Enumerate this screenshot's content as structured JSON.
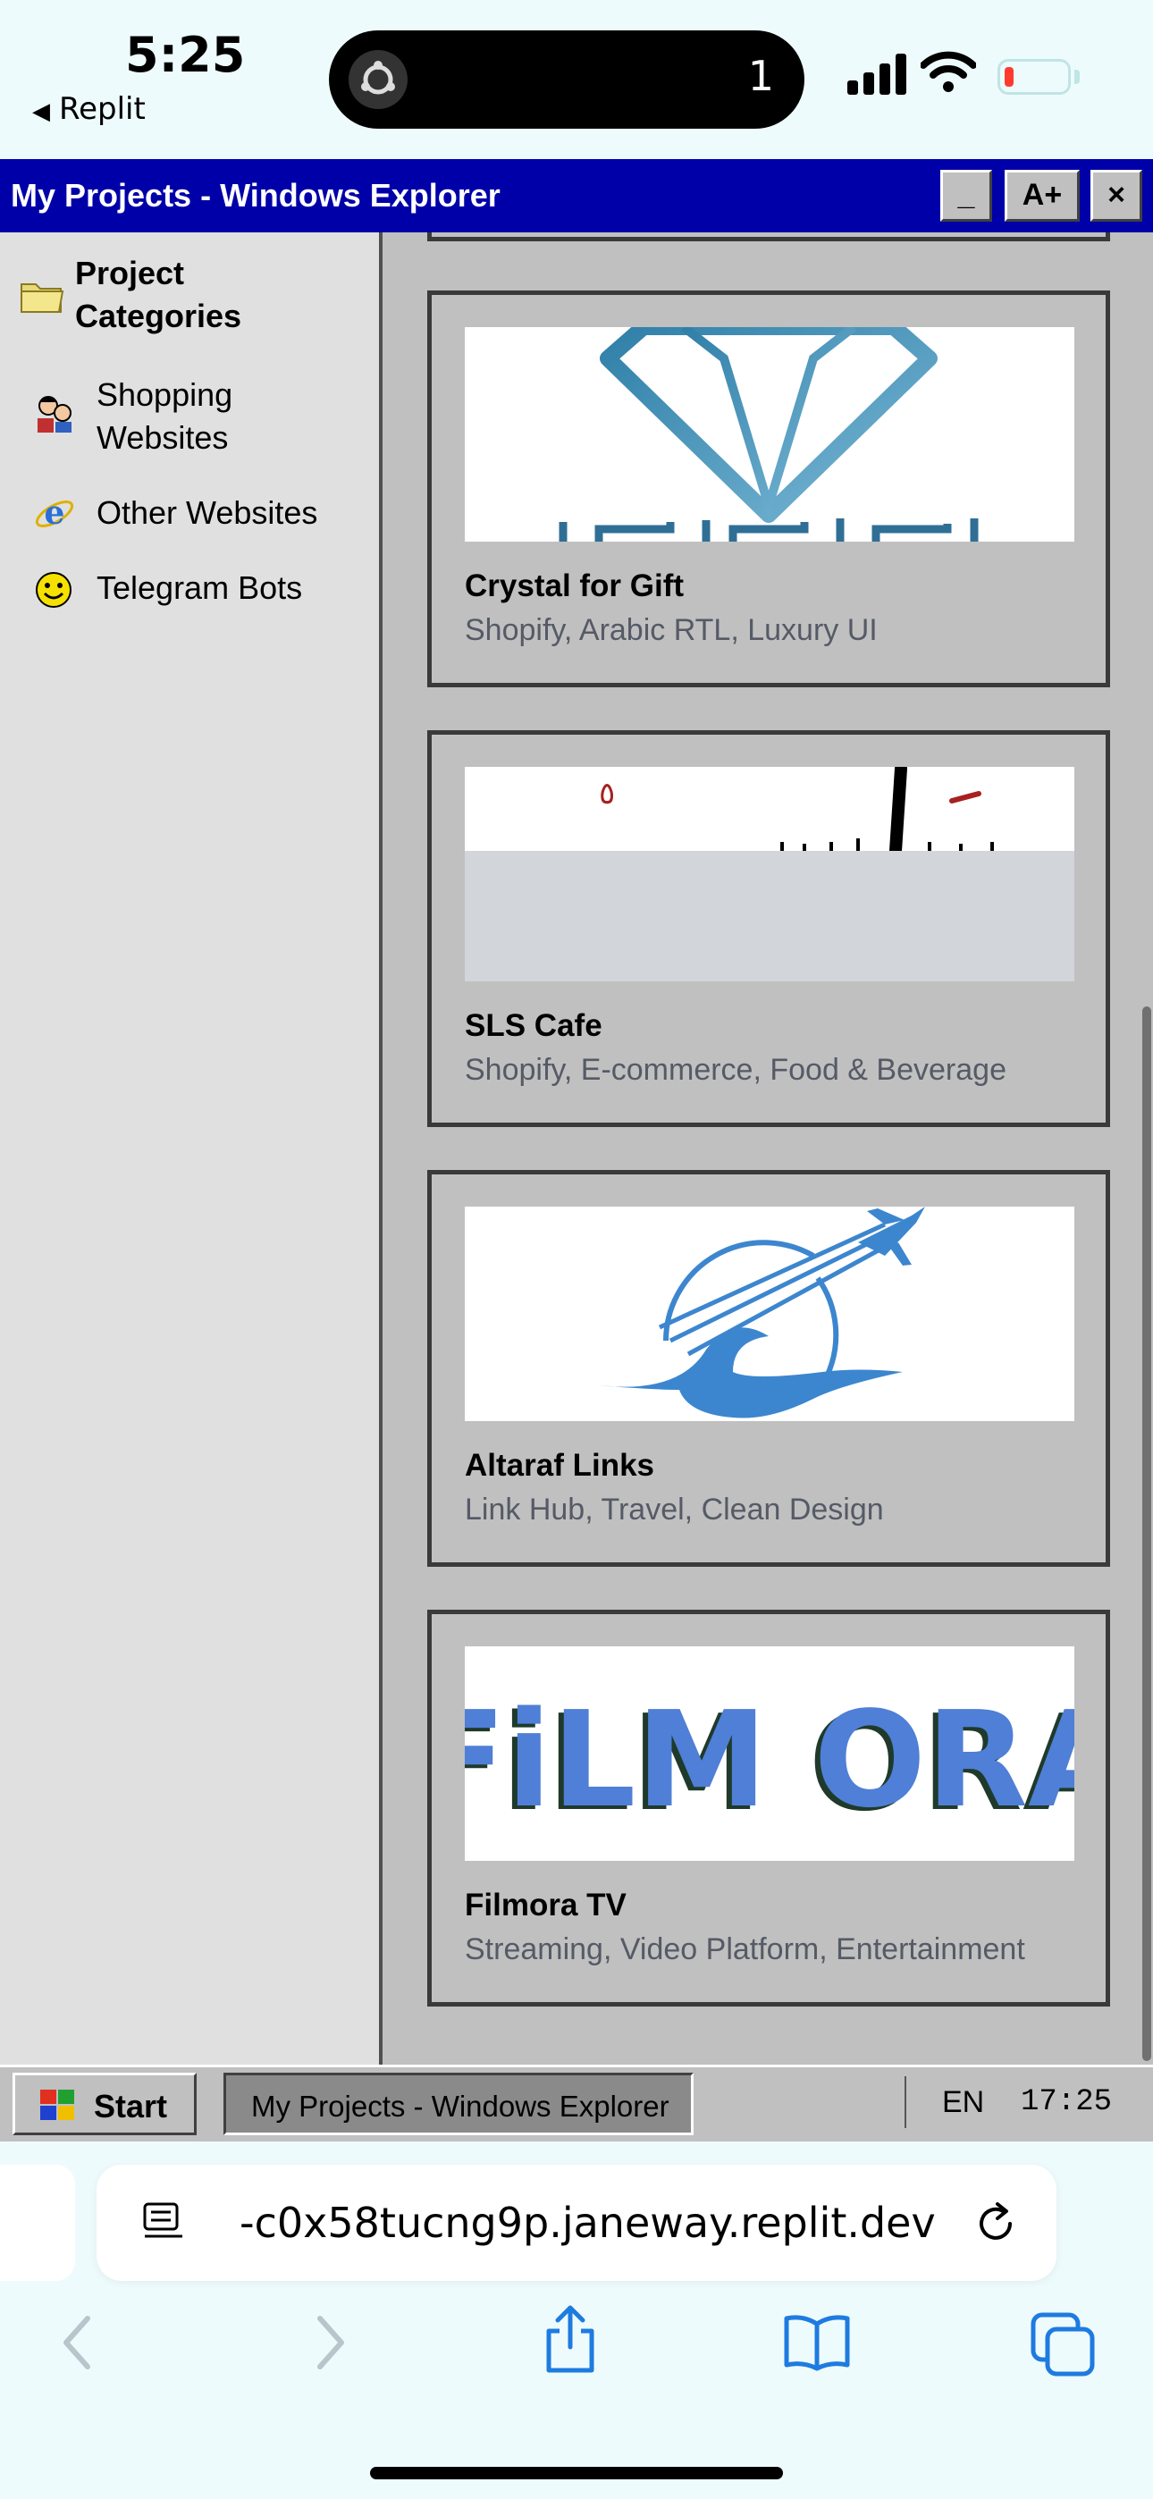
{
  "status_bar": {
    "time": "5:25",
    "back_app": "Replit",
    "island_count": "1",
    "battery_color": "#ff3b30"
  },
  "window": {
    "title": "My Projects - Windows Explorer",
    "buttons": {
      "minimize": "_",
      "font": "A+",
      "close": "×"
    },
    "title_color": "#0000a8"
  },
  "sidebar": {
    "heading": "Project Categories",
    "heading_icon": "folder-icon",
    "items": [
      {
        "label": "Shopping Websites",
        "icon": "shopping-people-icon"
      },
      {
        "label": "Other Websites",
        "icon": "internet-explorer-icon"
      },
      {
        "label": "Telegram Bots",
        "icon": "smiley-icon"
      }
    ]
  },
  "projects": [
    {
      "name": "Crystal for Gift",
      "tags": "Shopify, Arabic RTL, Luxury UI",
      "thumb": "diamond-logo"
    },
    {
      "name": "SLS Cafe",
      "tags": "Shopify, E-commerce, Food & Beverage",
      "thumb": "sls-cafe-logo",
      "thumb_mark": "٥"
    },
    {
      "name": "Altaraf Links",
      "tags": "Link Hub, Travel, Clean Design",
      "thumb": "plane-wave-logo"
    },
    {
      "name": "Filmora TV",
      "tags": "Streaming, Video Platform, Entertainment",
      "thumb": "filmora-logo",
      "thumb_text": "FiLM ORA"
    }
  ],
  "taskbar": {
    "start": "Start",
    "task": "My Projects - Windows Explorer",
    "lang": "EN",
    "clock": "17:25"
  },
  "safari": {
    "url": "-c0x58tucng9p.janeway.replit.dev"
  }
}
